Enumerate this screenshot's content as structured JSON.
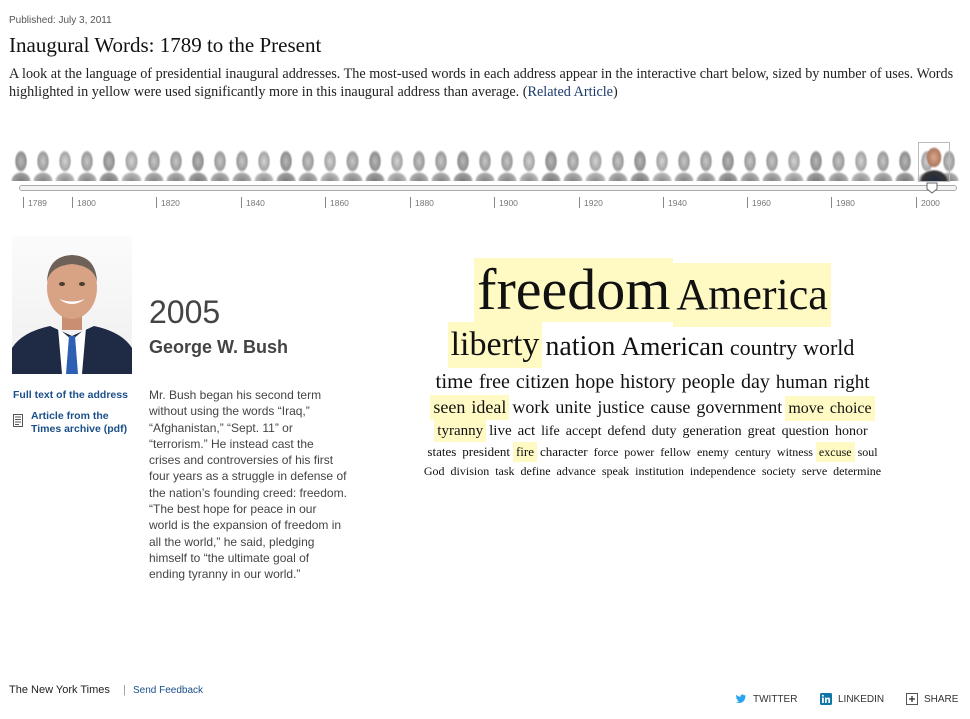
{
  "header": {
    "published": "Published: July 3, 2011",
    "title": "Inaugural Words: 1789 to the Present",
    "description": "A look at the language of presidential inaugural addresses. The most-used words in each address appear in the interactive chart below, sized by number of uses. Words highlighted in yellow were used significantly more in this inaugural address than average. (",
    "related_link": "Related Article",
    "description_end": ")"
  },
  "timeline": {
    "ticks": [
      "1789",
      "1800",
      "1820",
      "1840",
      "1860",
      "1880",
      "1900",
      "1920",
      "1940",
      "1960",
      "1980",
      "2000"
    ]
  },
  "address": {
    "year": "2005",
    "name": "George W. Bush",
    "full_text_link": "Full text of the address",
    "archive_link": "Article from the Times archive (pdf)",
    "summary": "Mr. Bush began his second term without using the words “Iraq,” “Afghanistan,” “Sept. 11” or “terrorism.” He instead cast the crises and controversies of his first four years as a struggle in defense of the nation’s founding creed: freedom. “The best hope for peace in our world is the expansion of freedom in all the world,” he said, pledging himself to “the ultimate goal of ending tyranny in our world.”"
  },
  "word_cloud": {
    "lines": [
      [
        "freedom",
        "America"
      ],
      [
        "liberty",
        "nation",
        "American",
        "country",
        "world"
      ],
      [
        "time",
        "free",
        "citizen",
        "hope",
        "history",
        "people",
        "day",
        "human",
        "right"
      ],
      [
        "seen",
        "ideal",
        "work",
        "unite",
        "justice",
        "cause",
        "government",
        "move",
        "choice"
      ],
      [
        "tyranny",
        "live",
        "act",
        "life",
        "accept",
        "defend",
        "duty",
        "generation",
        "great",
        "question",
        "honor"
      ],
      [
        "states",
        "president",
        "fire",
        "character",
        "force",
        "power",
        "fellow",
        "enemy",
        "century",
        "witness",
        "excuse",
        "soul"
      ],
      [
        "God",
        "division",
        "task",
        "define",
        "advance",
        "speak",
        "institution",
        "independence",
        "society",
        "serve",
        "determine"
      ]
    ],
    "highlighted": [
      "freedom",
      "America",
      "liberty",
      "seen",
      "ideal",
      "move",
      "choice",
      "tyranny",
      "fire",
      "excuse"
    ],
    "highlight_color": "#fffac4"
  },
  "footer": {
    "publisher": "The New York Times",
    "separator": "|",
    "feedback": "Send Feedback",
    "twitter": "TWITTER",
    "linkedin": "LINKEDIN",
    "share": "SHARE"
  },
  "colors": {
    "link": "#1a4f8a",
    "twitter": "#2aa3ef",
    "linkedin": "#0e76a8"
  }
}
